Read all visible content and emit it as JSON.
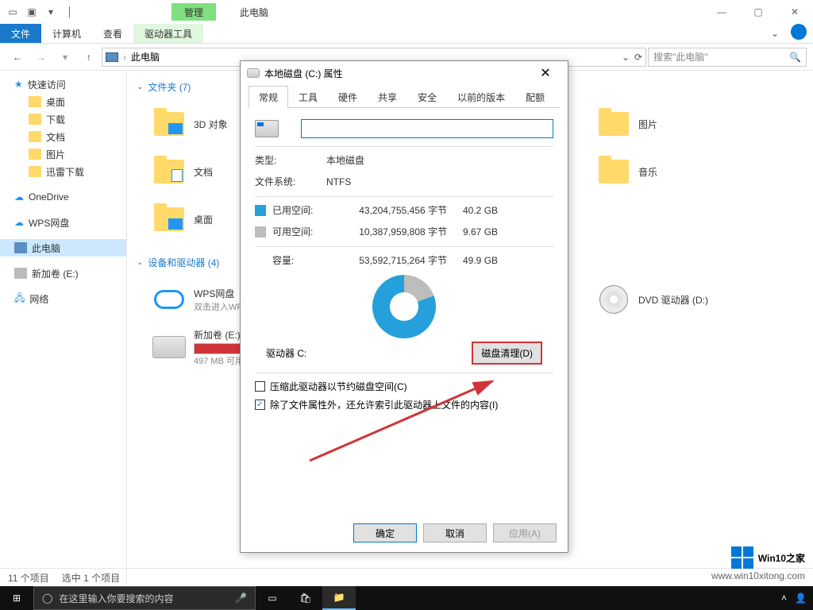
{
  "titlebar": {
    "contextual_tab": "管理",
    "title": "此电脑"
  },
  "ribbon": {
    "file": "文件",
    "tabs": [
      "计算机",
      "查看"
    ],
    "contextual": "驱动器工具"
  },
  "nav": {
    "location": "此电脑",
    "search_placeholder": "搜索\"此电脑\""
  },
  "sidebar": {
    "quick_access": "快速访问",
    "quick_items": [
      "桌面",
      "下载",
      "文档",
      "图片",
      "迅雷下载"
    ],
    "onedrive": "OneDrive",
    "wps": "WPS网盘",
    "this_pc": "此电脑",
    "new_volume": "新加卷 (E:)",
    "network": "网络"
  },
  "content": {
    "folders_header": "文件夹 (7)",
    "folders": [
      "3D 对象",
      "文档",
      "桌面",
      "图片",
      "音乐"
    ],
    "devices_header": "设备和驱动器 (4)",
    "wps_label": "WPS网盘",
    "wps_sub": "双击进入WPS",
    "new_vol_label": "新加卷 (E:)",
    "new_vol_sub": "497 MB 可用",
    "dvd_label": "DVD 驱动器 (D:)"
  },
  "statusbar": {
    "count": "11 个项目",
    "selected": "选中 1 个项目"
  },
  "taskbar": {
    "search_placeholder": "在这里输入你要搜索的内容"
  },
  "dialog": {
    "title": "本地磁盘 (C:) 属性",
    "tabs": [
      "常规",
      "工具",
      "硬件",
      "共享",
      "安全",
      "以前的版本",
      "配额"
    ],
    "type_label": "类型:",
    "type_value": "本地磁盘",
    "fs_label": "文件系统:",
    "fs_value": "NTFS",
    "used_label": "已用空间:",
    "used_bytes": "43,204,755,456 字节",
    "used_gb": "40.2 GB",
    "free_label": "可用空间:",
    "free_bytes": "10,387,959,808 字节",
    "free_gb": "9.67 GB",
    "capacity_label": "容量:",
    "capacity_bytes": "53,592,715,264 字节",
    "capacity_gb": "49.9 GB",
    "drive_label": "驱动器 C:",
    "cleanup_btn": "磁盘清理(D)",
    "compress_label": "压缩此驱动器以节约磁盘空间(C)",
    "index_label": "除了文件属性外，还允许索引此驱动器上文件的内容(I)",
    "ok": "确定",
    "cancel": "取消",
    "apply": "应用(A)"
  },
  "watermark": {
    "text": "Win10之家",
    "url": "www.win10xitong.com"
  }
}
